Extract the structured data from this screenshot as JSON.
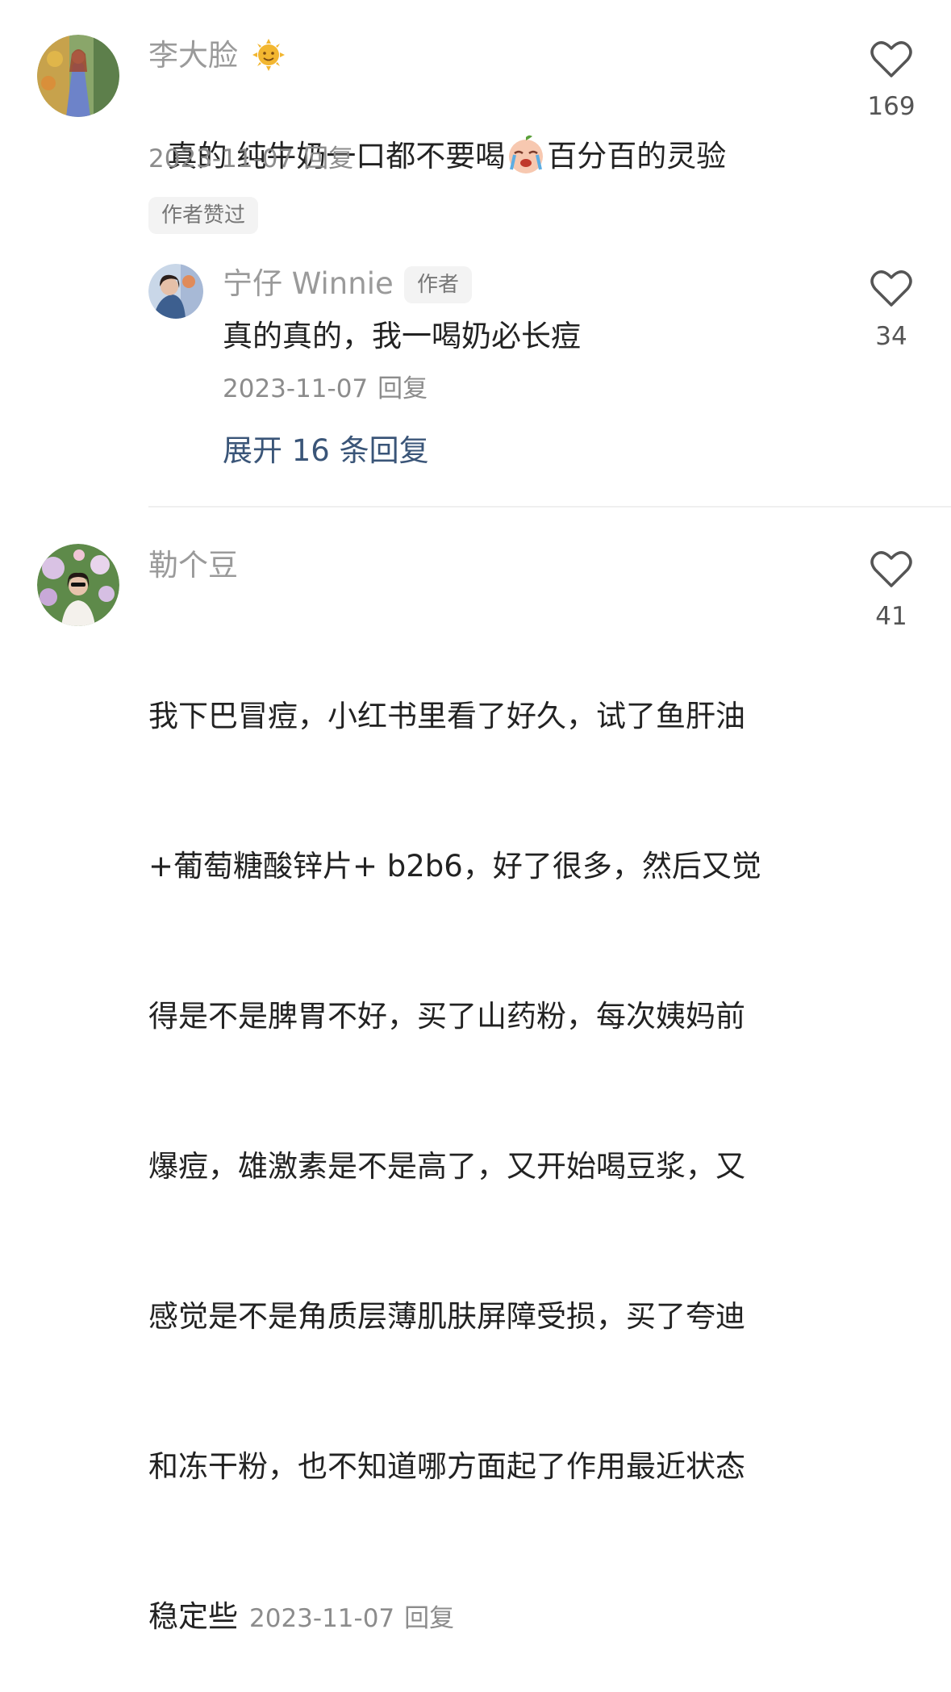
{
  "comments": [
    {
      "username": "李大脸",
      "username_emoji": "sun-face-icon",
      "content_before_emoji": "真的 纯牛奶一口都不要喝",
      "content_emoji": "crying-face-icon",
      "content_after_emoji": "百分百的灵验",
      "date": "2023-11-07",
      "reply_label": "回复",
      "author_liked_badge": "作者赞过",
      "like_count": "169",
      "replies": [
        {
          "username": "宁仔 Winnie",
          "author_badge": "作者",
          "content": "真的真的，我一喝奶必长痘",
          "date": "2023-11-07",
          "reply_label": "回复",
          "like_count": "34"
        }
      ],
      "expand_label": "展开 16 条回复"
    },
    {
      "username": "勒个豆",
      "content_lines": [
        "我下巴冒痘，小红书里看了好久，试了鱼肝油",
        "+葡萄糖酸锌片+ b2b6，好了很多，然后又觉",
        "得是不是脾胃不好，买了山药粉，每次姨妈前",
        "爆痘，雄激素是不是高了，又开始喝豆浆，又",
        "感觉是不是角质层薄肌肤屏障受损，买了夸迪",
        "和冻干粉，也不知道哪方面起了作用最近状态"
      ],
      "content_last_line": "稳定些",
      "date": "2023-11-07",
      "reply_label": "回复",
      "like_count": "41"
    }
  ],
  "colors": {
    "username": "#9a9a9a",
    "text": "#222222",
    "meta": "#8c8c8c",
    "link": "#3a5578",
    "badge_bg": "#f3f3f3"
  }
}
